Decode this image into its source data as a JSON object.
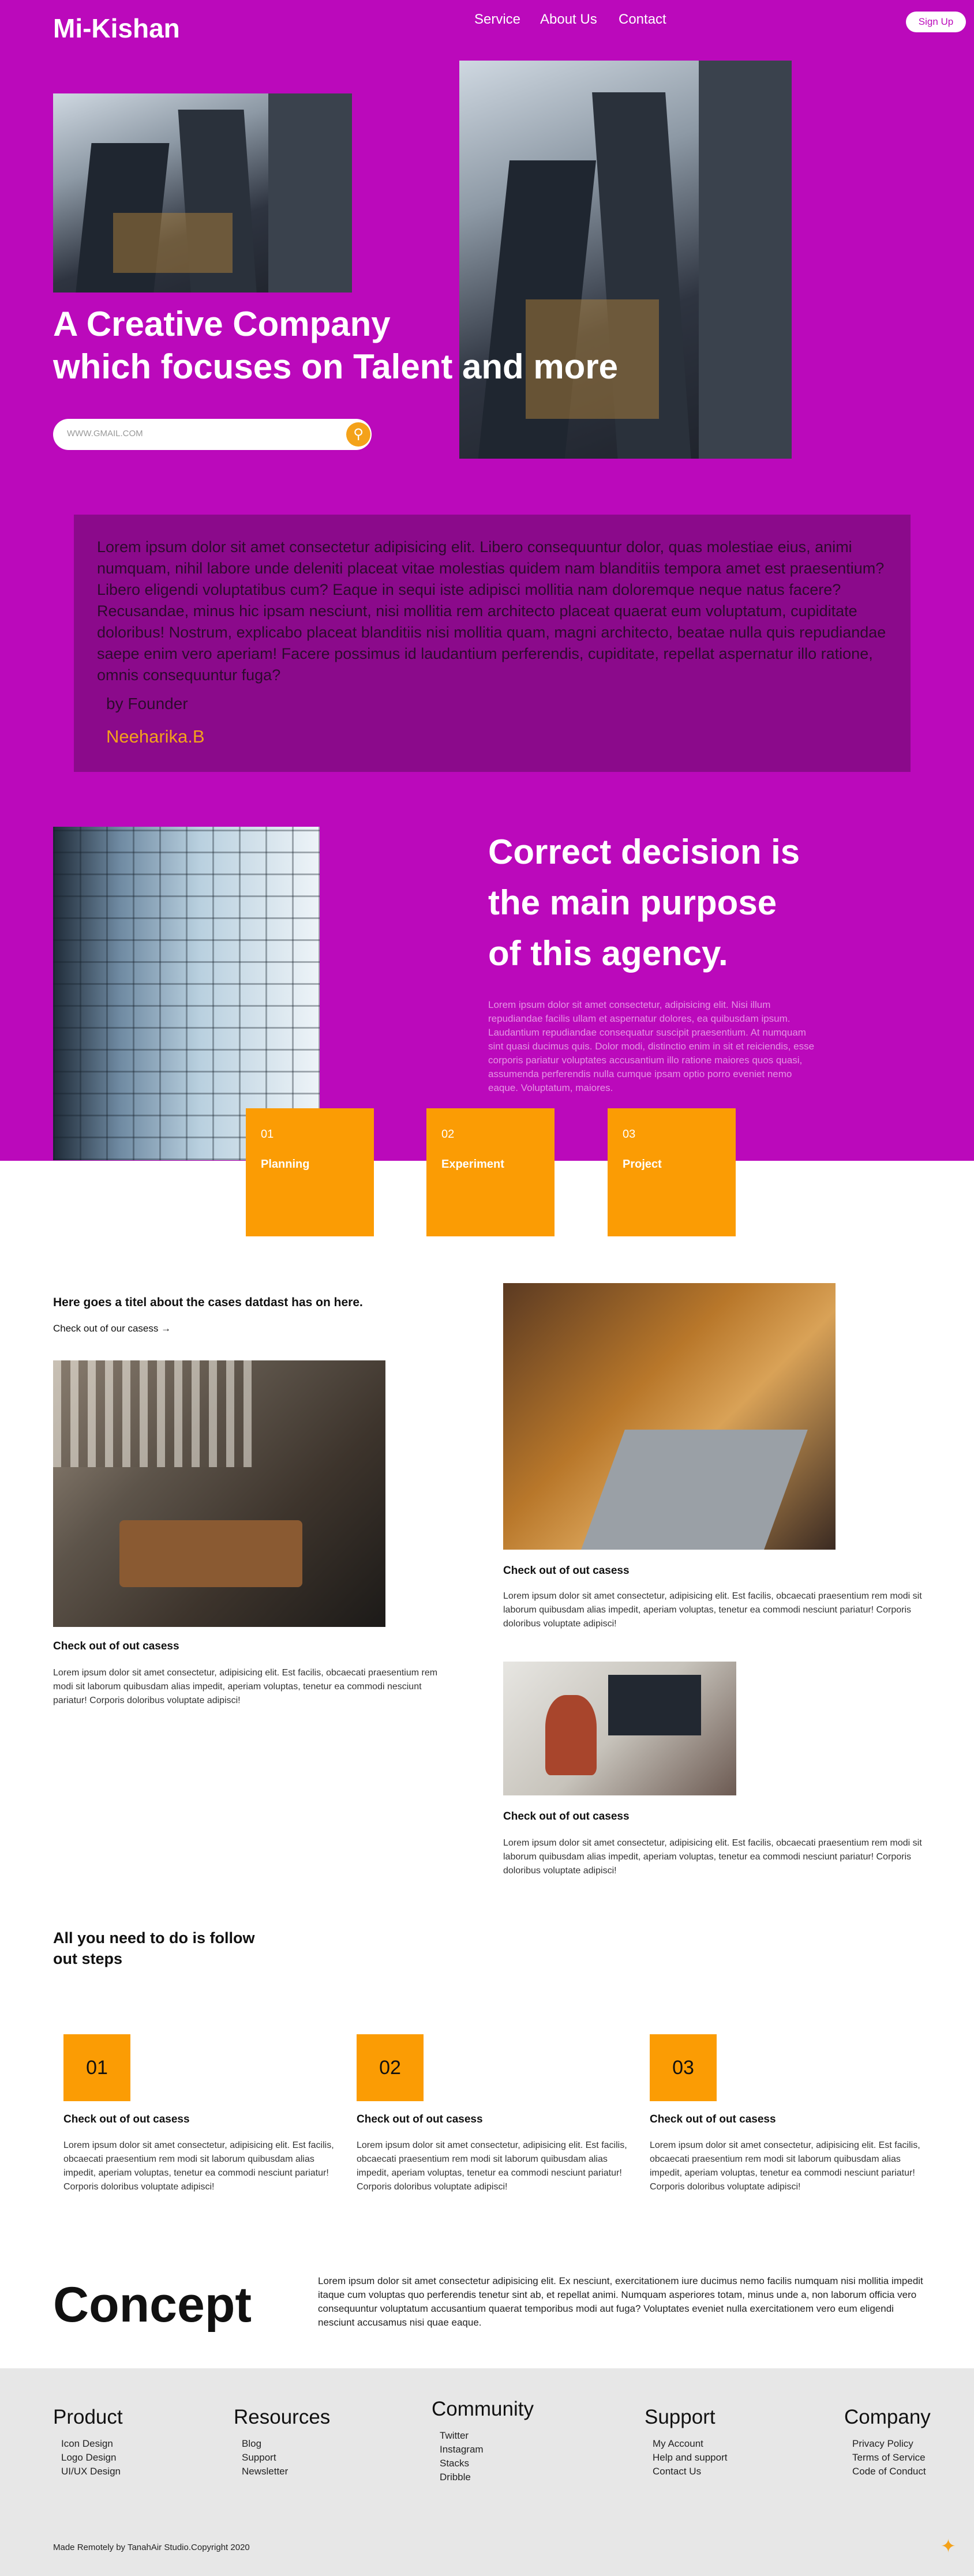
{
  "header": {
    "logo": "Mi-Kishan",
    "nav": [
      "Service",
      "About Us",
      "Contact"
    ],
    "signup_label": "Sign Up"
  },
  "hero": {
    "title_line1": "A Creative Company",
    "title_line2": "which focuses on Talent and more",
    "email_placeholder": "WWW.GMAIL.COM",
    "submit_icon": "search-icon"
  },
  "testimonial": {
    "text": "Lorem ipsum dolor sit amet consectetur adipisicing elit. Libero consequuntur dolor, quas molestiae eius, animi numquam, nihil labore unde deleniti placeat vitae molestias quidem nam blanditiis tempora amet est praesentium? Libero eligendi voluptatibus cum? Eaque in sequi iste adipisci mollitia nam doloremque neque natus facere? Recusandae, minus hic ipsam nesciunt, nisi mollitia rem architecto placeat quaerat eum voluptatum, cupiditate doloribus! Nostrum, explicabo placeat blanditiis nisi mollitia quam, magni architecto, beatae nulla quis repudiandae saepe enim vero aperiam! Facere possimus id laudantium perferendis, cupiditate, repellat aspernatur illo ratione, omnis consequuntur fuga?",
    "by_label": "by Founder",
    "author": "Neeharika.B"
  },
  "agency": {
    "title_line1": "Correct decision is",
    "title_line2": "the main purpose",
    "title_line3": "of this agency.",
    "text": "Lorem ipsum dolor sit amet consectetur, adipisicing elit. Nisi illum repudiandae facilis ullam et aspernatur dolores, ea quibusdam ipsum. Laudantium repudiandae consequatur suscipit praesentium. At numquam sint quasi ducimus quis. Dolor modi, distinctio enim in sit et reiciendis, esse corporis pariatur voluptates accusantium illo ratione maiores quos quasi, assumenda perferendis nulla cumque ipsam optio porro eveniet nemo eaque. Voluptatum, maiores."
  },
  "process": [
    {
      "num": "01",
      "title": "Planning"
    },
    {
      "num": "02",
      "title": "Experiment"
    },
    {
      "num": "03",
      "title": "Project"
    }
  ],
  "cases": {
    "heading": "Here goes a titel about the cases datdast has on here.",
    "link": "Check out of our casess",
    "card_title": "Check out of out casess",
    "card_text": "Lorem ipsum dolor sit amet consectetur, adipisicing elit. Est facilis, obcaecati praesentium rem modi sit laborum quibusdam alias impedit, aperiam voluptas, tenetur ea commodi nesciunt pariatur! Corporis doloribus voluptate adipisci!"
  },
  "follow": {
    "heading_line1": "All you need to do is follow",
    "heading_line2": "out steps",
    "steps": [
      {
        "num": "01",
        "title": "Check out of out casess",
        "text": "Lorem ipsum dolor sit amet consectetur, adipisicing elit. Est facilis, obcaecati praesentium rem modi sit laborum quibusdam alias impedit, aperiam voluptas, tenetur ea commodi nesciunt pariatur! Corporis doloribus voluptate adipisci!"
      },
      {
        "num": "02",
        "title": "Check out of out casess",
        "text": "Lorem ipsum dolor sit amet consectetur, adipisicing elit. Est facilis, obcaecati praesentium rem modi sit laborum quibusdam alias impedit, aperiam voluptas, tenetur ea commodi nesciunt pariatur! Corporis doloribus voluptate adipisci!"
      },
      {
        "num": "03",
        "title": "Check out of out casess",
        "text": "Lorem ipsum dolor sit amet consectetur, adipisicing elit. Est facilis, obcaecati praesentium rem modi sit laborum quibusdam alias impedit, aperiam voluptas, tenetur ea commodi nesciunt pariatur! Corporis doloribus voluptate adipisci!"
      }
    ]
  },
  "concept": {
    "title": "Concept",
    "text": "Lorem ipsum dolor sit amet consectetur adipisicing elit. Ex nesciunt, exercitationem iure ducimus nemo facilis numquam nisi mollitia impedit itaque cum voluptas quo perferendis tenetur sint ab, et repellat animi. Numquam asperiores totam, minus unde a, non laborum officia vero consequuntur voluptatum accusantium quaerat temporibus modi aut fuga? Voluptates eveniet nulla exercitationem vero eum eligendi nesciunt accusamus nisi quae eaque."
  },
  "footer": {
    "columns": [
      {
        "title": "Product",
        "items": [
          "Icon Design",
          "Logo Design",
          "UI/UX Design"
        ]
      },
      {
        "title": "Resources",
        "items": [
          "Blog",
          "Support",
          "Newsletter"
        ]
      },
      {
        "title": "Community",
        "items": [
          "Twitter",
          "Instagram",
          "Stacks",
          "Dribble"
        ]
      },
      {
        "title": "Support",
        "items": [
          "My Account",
          "Help and support",
          "Contact Us"
        ]
      },
      {
        "title": "Company",
        "items": [
          "Privacy Policy",
          "Terms of Service",
          "Code of Conduct"
        ]
      }
    ],
    "copyright": "Made Remotely by TanahAir Studio.Copyright 2020"
  },
  "colors": {
    "brand_magenta": "#bb09bb",
    "quote_bg": "#8b0a8b",
    "accent_orange": "#fb9c04",
    "footer_bg": "#e7e7e7"
  }
}
